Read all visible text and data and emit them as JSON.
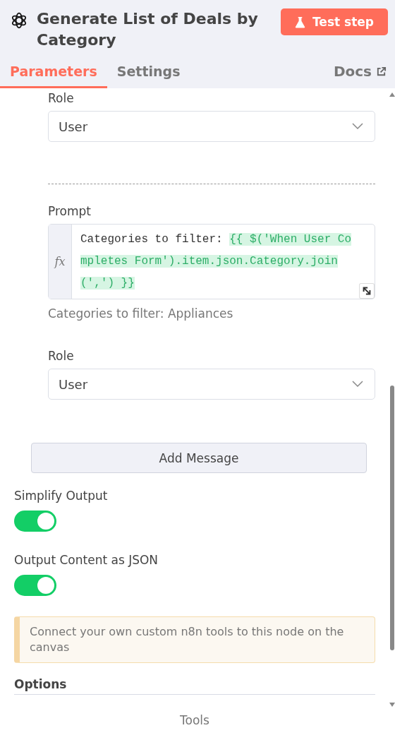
{
  "header": {
    "title": "Generate List of Deals by Category",
    "test_button": "Test step"
  },
  "tabs": [
    {
      "label": "Parameters",
      "selected": true
    },
    {
      "label": "Settings",
      "selected": false
    }
  ],
  "docs_link": "Docs",
  "messages": [
    {
      "kind": "role",
      "label": "Role",
      "value": "User"
    },
    {
      "kind": "prompt",
      "label": "Prompt",
      "fx": "fx",
      "text": "Categories to filter: ",
      "expression": "{{ $('When User Completes Form').item.json.Category.join(',') }}",
      "preview": "Categories to filter: Appliances"
    },
    {
      "kind": "role",
      "label": "Role",
      "value": "User"
    }
  ],
  "add_message_button": "Add Message",
  "toggles": [
    {
      "label": "Simplify Output",
      "on": true
    },
    {
      "label": "Output Content as JSON",
      "on": true
    }
  ],
  "notice": "Connect your own custom n8n tools to this node on the canvas",
  "options": {
    "heading": "Options",
    "item": "Tools"
  }
}
